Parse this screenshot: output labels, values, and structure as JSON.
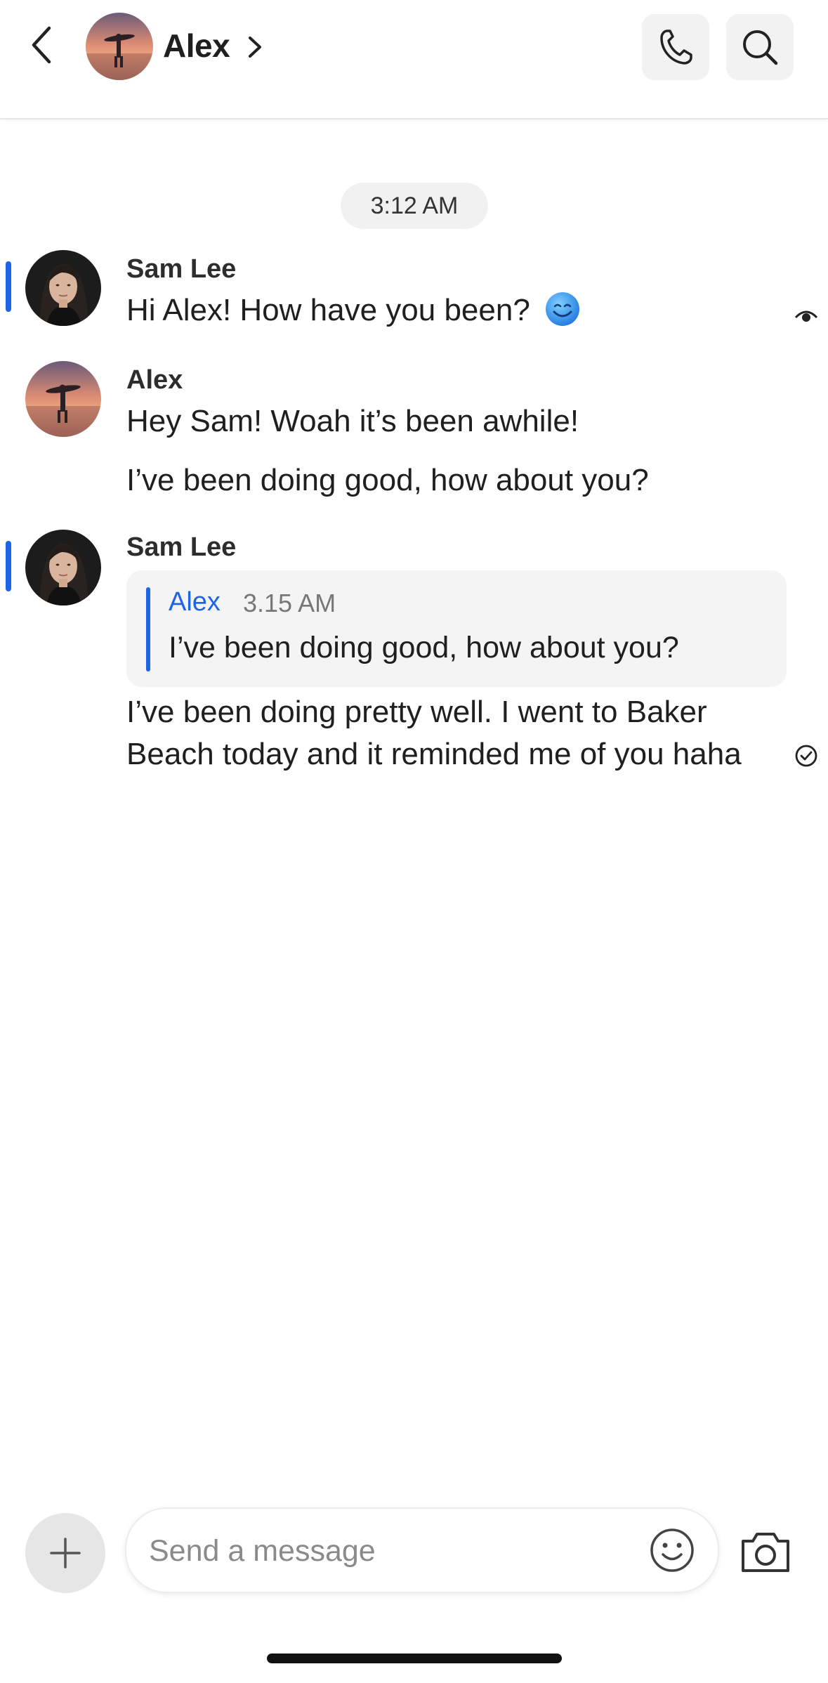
{
  "header": {
    "contact_name": "Alex"
  },
  "chat": {
    "timestamp": "3:12 AM",
    "messages": [
      {
        "sender": "Sam Lee",
        "text": "Hi Alex! How have you been?"
      },
      {
        "sender": "Alex",
        "lines": [
          "Hey Sam! Woah it’s been awhile!",
          "I’ve been doing good, how about you?"
        ]
      },
      {
        "sender": "Sam Lee",
        "quote": {
          "author": "Alex",
          "time": "3.15 AM",
          "text": "I’ve been doing good, how about you?"
        },
        "lines": [
          "I’ve been doing pretty well. I went to Baker",
          "Beach today and it reminded me of you haha"
        ]
      }
    ]
  },
  "composer": {
    "placeholder": "Send a message"
  },
  "colors": {
    "accent": "#1f63e6",
    "pill_bg": "#f1f1f1",
    "quote_bg": "#f4f4f4"
  },
  "icons": {
    "back": "chevron-left-icon",
    "call": "phone-icon",
    "search": "search-icon",
    "plus": "plus-icon",
    "emoji": "smiley-icon",
    "camera": "camera-icon",
    "seen": "eye-icon",
    "delivered": "check-circle-icon"
  }
}
